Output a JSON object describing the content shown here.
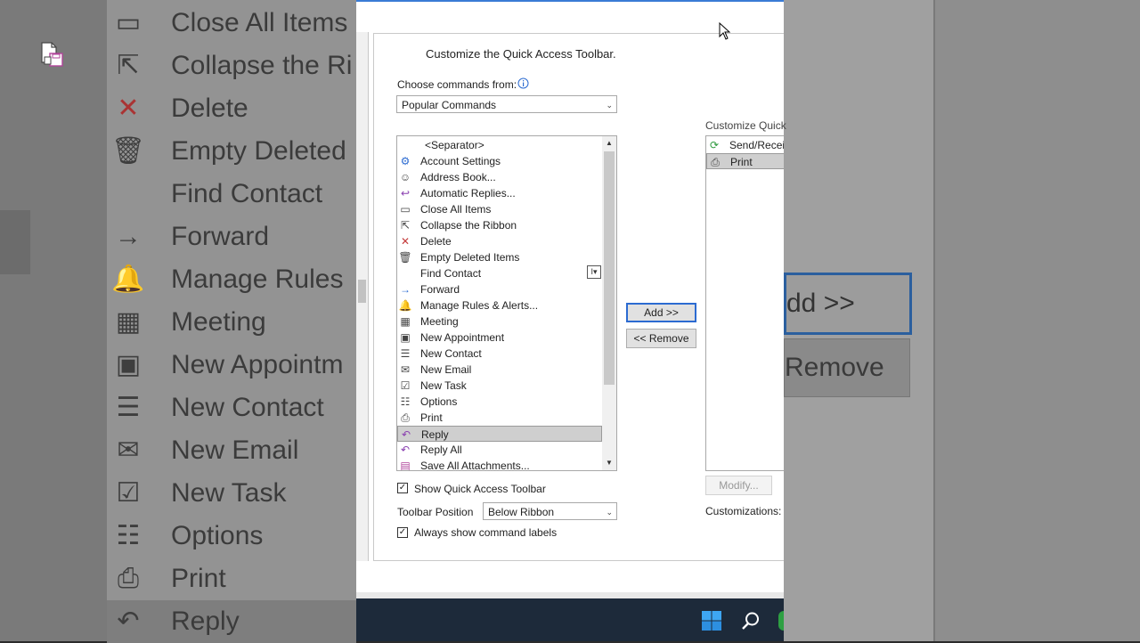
{
  "background": {
    "left_items": [
      {
        "icon": "close-all-items-icon",
        "glyph": "▭",
        "label": "Close All Items"
      },
      {
        "icon": "collapse-ribbon-icon",
        "glyph": "⇱",
        "label": "Collapse the Ri"
      },
      {
        "icon": "delete-icon",
        "glyph": "✕",
        "label": "Delete"
      },
      {
        "icon": "empty-deleted-icon",
        "glyph": "🗑",
        "label": "Empty Deleted"
      },
      {
        "icon": "",
        "glyph": "",
        "label": "Find Contact"
      },
      {
        "icon": "forward-icon",
        "glyph": "→",
        "label": "Forward"
      },
      {
        "icon": "manage-rules-icon",
        "glyph": "🔔",
        "label": "Manage Rules"
      },
      {
        "icon": "meeting-icon",
        "glyph": "▦",
        "label": "Meeting"
      },
      {
        "icon": "new-appointment-icon",
        "glyph": "▣",
        "label": "New Appointm"
      },
      {
        "icon": "new-contact-icon",
        "glyph": "☰",
        "label": "New Contact"
      },
      {
        "icon": "new-email-icon",
        "glyph": "✉",
        "label": "New Email"
      },
      {
        "icon": "new-task-icon",
        "glyph": "☑",
        "label": "New Task"
      },
      {
        "icon": "options-icon",
        "glyph": "☷",
        "label": "Options"
      },
      {
        "icon": "print-icon",
        "glyph": "⎙",
        "label": "Print"
      },
      {
        "icon": "reply-icon",
        "glyph": "↶",
        "label": "Reply"
      }
    ],
    "right_add_label": "dd >>",
    "right_remove_label": "Remove"
  },
  "dialog": {
    "heading": "Customize the Quick Access Toolbar.",
    "choose_label": "Choose commands from:",
    "choose_value": "Popular Commands",
    "commands": [
      {
        "icon": "",
        "glyph": "",
        "label": "<Separator>",
        "selected": false
      },
      {
        "icon": "account-settings-icon",
        "glyph": "⚙",
        "label": "Account Settings",
        "selected": false
      },
      {
        "icon": "address-book-icon",
        "glyph": "☺",
        "label": "Address Book...",
        "selected": false
      },
      {
        "icon": "automatic-replies-icon",
        "glyph": "↩",
        "label": "Automatic Replies...",
        "selected": false
      },
      {
        "icon": "close-all-items-icon",
        "glyph": "▭",
        "label": "Close All Items",
        "selected": false
      },
      {
        "icon": "collapse-ribbon-icon",
        "glyph": "⇱",
        "label": "Collapse the Ribbon",
        "selected": false
      },
      {
        "icon": "delete-icon",
        "glyph": "✕",
        "label": "Delete",
        "selected": false
      },
      {
        "icon": "empty-deleted-icon",
        "glyph": "🗑",
        "label": "Empty Deleted Items",
        "selected": false
      },
      {
        "icon": "",
        "glyph": "",
        "label": "Find Contact",
        "selected": false
      },
      {
        "icon": "forward-icon",
        "glyph": "→",
        "label": "Forward",
        "selected": false
      },
      {
        "icon": "manage-rules-icon",
        "glyph": "🔔",
        "label": "Manage Rules & Alerts...",
        "selected": false
      },
      {
        "icon": "meeting-icon",
        "glyph": "▦",
        "label": "Meeting",
        "selected": false
      },
      {
        "icon": "new-appointment-icon",
        "glyph": "▣",
        "label": "New Appointment",
        "selected": false
      },
      {
        "icon": "new-contact-icon",
        "glyph": "☰",
        "label": "New Contact",
        "selected": false
      },
      {
        "icon": "new-email-icon",
        "glyph": "✉",
        "label": "New Email",
        "selected": false
      },
      {
        "icon": "new-task-icon",
        "glyph": "☑",
        "label": "New Task",
        "selected": false
      },
      {
        "icon": "options-icon",
        "glyph": "☷",
        "label": "Options",
        "selected": false
      },
      {
        "icon": "print-icon",
        "glyph": "⎙",
        "label": "Print",
        "selected": false
      },
      {
        "icon": "reply-icon",
        "glyph": "↶",
        "label": "Reply",
        "selected": true
      },
      {
        "icon": "reply-all-icon",
        "glyph": "↶",
        "label": "Reply All",
        "selected": false
      },
      {
        "icon": "save-attachments-icon",
        "glyph": "▤",
        "label": "Save All Attachments...",
        "selected": false
      }
    ],
    "add_button": "Add >>",
    "remove_button": "<< Remove",
    "right_header": "Customize Quick",
    "toolbar_items": [
      {
        "icon": "send-receive-icon",
        "glyph": "⟳",
        "label": "Send/Receiv"
      },
      {
        "icon": "print-icon",
        "glyph": "⎙",
        "label": "Print"
      }
    ],
    "modify_button": "Modify...",
    "customizations_label": "Customizations:",
    "show_qat_label": "Show Quick Access Toolbar",
    "show_qat_checked": true,
    "toolbar_position_label": "Toolbar Position",
    "toolbar_position_value": "Below Ribbon",
    "always_show_labels_label": "Always show command labels",
    "always_show_labels_checked": true
  },
  "colors": {
    "accent": "#2c6bd1",
    "selection": "#cfcfcf",
    "taskbar": "#1d2a3a"
  }
}
